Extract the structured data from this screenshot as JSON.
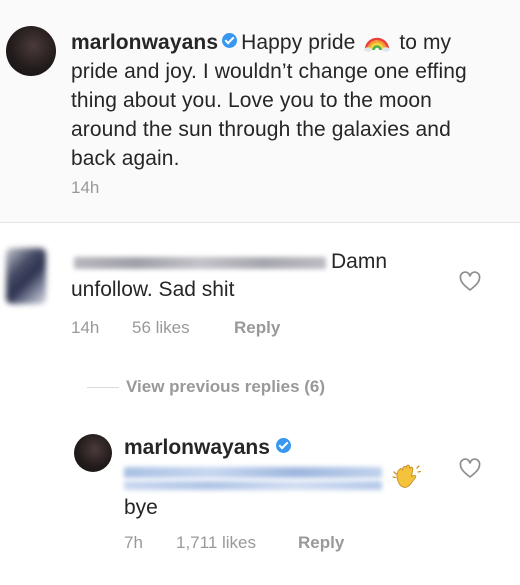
{
  "caption": {
    "username": "marlonwayans",
    "text_before_emoji": "Happy pride",
    "text_after_emoji": "to my pride and joy. I wouldn’t change one effing thing about you. Love you to the moon around the sun through the galaxies and back again.",
    "emoji": "rainbow-icon",
    "time": "14h"
  },
  "comment1": {
    "text_end_line1": "Damn",
    "text_line2": "unfollow. Sad shit",
    "time": "14h",
    "likes": "56 likes",
    "reply_label": "Reply"
  },
  "view_previous": "View previous replies (6)",
  "reply": {
    "username": "marlonwayans",
    "emoji": "waving-hand-icon",
    "text": "bye",
    "time": "7h",
    "likes": "1,711 likes",
    "reply_label": "Reply"
  },
  "colors": {
    "verified": "#3897f0",
    "meta_text": "#999999",
    "body_text": "#262626"
  }
}
